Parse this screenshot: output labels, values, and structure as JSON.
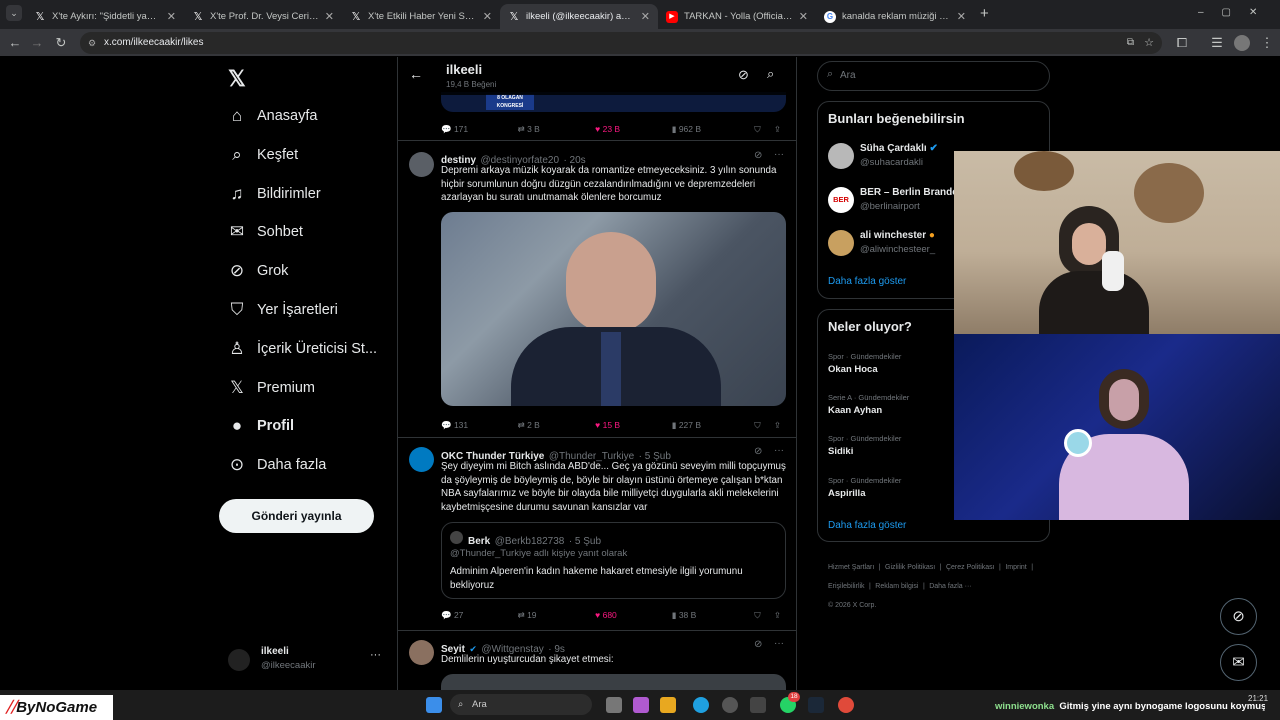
{
  "browser": {
    "tabs": [
      {
        "title": "X'te Aykırı: \"Şiddetli yağışların e",
        "icon": "x-logo-icon"
      },
      {
        "title": "X'te Prof. Dr. Veysi Ceri: \"Yüzler",
        "icon": "x-logo-icon"
      },
      {
        "title": "X'te Etkili Haber Yeni Sayfa: \"Lo",
        "icon": "x-logo-icon"
      },
      {
        "title": "ilkeeli (@ilkeecaakir) adlı kullanı",
        "icon": "x-logo-icon"
      },
      {
        "title": "TARKAN - Yolla (Official Music V",
        "icon": "youtube-icon"
      },
      {
        "title": "kanalda reklam müziği - Google",
        "icon": "google-icon"
      }
    ],
    "url": "x.com/ilkeecaakir/likes",
    "new_tab": "+"
  },
  "sidebar": {
    "items": [
      {
        "label": "Anasayfa",
        "icon": "home-icon"
      },
      {
        "label": "Keşfet",
        "icon": "search-icon"
      },
      {
        "label": "Bildirimler",
        "icon": "bell-icon"
      },
      {
        "label": "Sohbet",
        "icon": "mail-icon"
      },
      {
        "label": "Grok",
        "icon": "grok-icon"
      },
      {
        "label": "Yer İşaretleri",
        "icon": "bookmark-icon"
      },
      {
        "label": "İçerik Üreticisi St...",
        "icon": "creator-studio-icon"
      },
      {
        "label": "Premium",
        "icon": "x-premium-icon"
      },
      {
        "label": "Profil",
        "icon": "person-icon"
      },
      {
        "label": "Daha fazla",
        "icon": "more-circle-icon"
      }
    ],
    "post_button": "Gönderi yayınla",
    "account": {
      "name": "ilkeeli",
      "handle": "@ilkeecaakir",
      "more": "···"
    }
  },
  "header": {
    "title": "ilkeeli",
    "subtitle": "19,4 B Beğeni"
  },
  "feed": {
    "top_actions": {
      "replies": "171",
      "reposts": "3 B",
      "likes": "23 B",
      "views": "962 B"
    },
    "media_caption": "8 OLAĞAN KONGRESİ",
    "tweets": [
      {
        "name": "destiny",
        "handle": "@destinyorfate20",
        "time": "· 20s",
        "text": "Depremi arkaya müzik koyarak da romantize etmeyeceksiniz. 3 yılın sonunda hiçbir sorumlunun doğru düzgün cezalandırılmadığını ve depremzedeleri azarlayan bu suratı unutmamak ölenlere borcumuz",
        "replies": "131",
        "reposts": "2 B",
        "likes": "15 B",
        "views": "227 B"
      },
      {
        "name": "OKC Thunder Türkiye",
        "handle": "@Thunder_Turkiye",
        "time": "· 5 Şub",
        "text": "Şey diyeyim mi Bitch aslında ABD'de... Geç ya gözünü seveyim milli topçuymuş da şöyleymiş de böyleymiş de, böyle bir olayın üstünü örtemeye çalışan b*ktan NBA sayfalarımız ve böyle bir olayda bile milliyetçi duygularla akli melekelerini kaybetmişçesine durumu savunan kansızlar var",
        "quote": {
          "name": "Berk",
          "handle": "@Berkb182738",
          "time": "· 5 Şub",
          "reply_to": "@Thunder_Turkiye adlı kişiye yanıt olarak",
          "text": "Adminim Alperen'in kadın hakeme hakaret etmesiyle ilgili yorumunu bekliyoruz"
        },
        "replies": "27",
        "reposts": "19",
        "likes": "680",
        "views": "38 B"
      },
      {
        "name": "Seyit",
        "handle": "@Wittgenstay",
        "time": "· 9s",
        "text": "Demlilerin uyuşturcudan şikayet etmesi:"
      }
    ]
  },
  "right": {
    "search_placeholder": "Ara",
    "suggest_title": "Bunları beğenebilirsin",
    "suggestions": [
      {
        "name": "Süha Çardaklı",
        "handle": "@suhacardakli"
      },
      {
        "name": "BER – Berlin Brande",
        "handle": "@berlinairport"
      },
      {
        "name": "ali winchester",
        "handle": "@aliwinchesteer_"
      }
    ],
    "show_more": "Daha fazla göster",
    "trends_title": "Neler oluyor?",
    "trends": [
      {
        "context": "Spor · Gündemdekiler",
        "name": "Okan Hoca"
      },
      {
        "context": "Serie A · Gündemdekiler",
        "name": "Kaan Ayhan"
      },
      {
        "context": "Spor · Gündemdekiler",
        "name": "Sidiki"
      },
      {
        "context": "Spor · Gündemdekiler",
        "name": "Aspirilla"
      }
    ],
    "trends_more": "Daha fazla göster",
    "footer": [
      "Hizmet Şartları",
      "Gizlilik Politikası",
      "Çerez Politikası",
      "Imprint",
      "Erişilebilirlik",
      "Reklam bilgisi",
      "Daha fazla ···"
    ],
    "copyright": "© 2026 X Corp."
  },
  "overlay": {
    "logo": "ByNoGame",
    "chat_user": "winniewonka",
    "chat_msg": "Gitmiş yine aynı bynogame logosunu koymuş..."
  },
  "taskbar": {
    "search": "Ara",
    "time": "21:21",
    "badge": "18"
  },
  "colors": {
    "accent": "#1d9bf0",
    "like": "#f91880",
    "bg": "#000000",
    "border": "#2f3336"
  }
}
